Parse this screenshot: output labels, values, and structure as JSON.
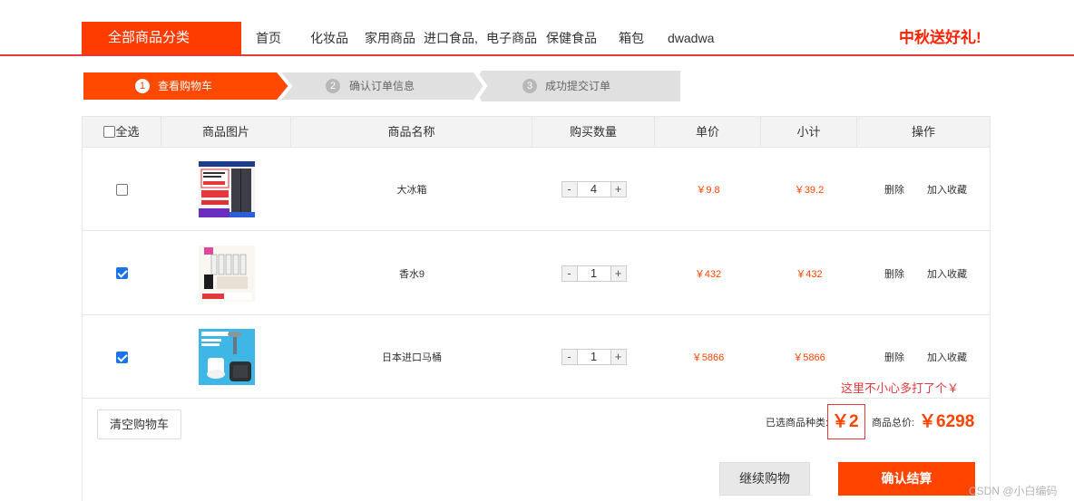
{
  "header": {
    "category_button": "全部商品分类",
    "nav": [
      "首页",
      "化妆品",
      "家用商品",
      "进口食品,",
      "电子商品",
      "保健食品",
      "箱包",
      "dwadwa"
    ],
    "promo": "中秋送好礼!"
  },
  "steps": [
    {
      "num": "1",
      "label": "查看购物车",
      "active": true
    },
    {
      "num": "2",
      "label": "确认订单信息",
      "active": false
    },
    {
      "num": "3",
      "label": "成功提交订单",
      "active": false
    }
  ],
  "table": {
    "headers": {
      "select_all": "全选",
      "image": "商品图片",
      "name": "商品名称",
      "quantity": "购买数量",
      "unit_price": "单价",
      "subtotal": "小计",
      "actions": "操作"
    },
    "rows": [
      {
        "checked": false,
        "name": "大冰箱",
        "quantity": "4",
        "unit_price": "￥9.8",
        "subtotal": "￥39.2",
        "delete": "删除",
        "favorite": "加入收藏"
      },
      {
        "checked": true,
        "name": "香水9",
        "quantity": "1",
        "unit_price": "￥432",
        "subtotal": "￥432",
        "delete": "删除",
        "favorite": "加入收藏"
      },
      {
        "checked": true,
        "name": "日本进口马桶",
        "quantity": "1",
        "unit_price": "￥5866",
        "subtotal": "￥5866",
        "delete": "删除",
        "favorite": "加入收藏"
      }
    ],
    "stepper": {
      "minus": "-",
      "plus": "+"
    }
  },
  "footer": {
    "clear_button": "清空购物车",
    "annotation": "这里不小心多打了个￥",
    "selected_kinds_label": "已选商品种类:",
    "selected_kinds_value": "￥2",
    "total_label": "商品总价:",
    "total_value": "￥6298",
    "continue_button": "继续购物",
    "checkout_button": "确认结算"
  },
  "watermark": "CSDN @小白编码",
  "colors": {
    "accent": "#ff4400",
    "header_rule": "#e4393c",
    "step_inactive": "#e0e0e0"
  }
}
